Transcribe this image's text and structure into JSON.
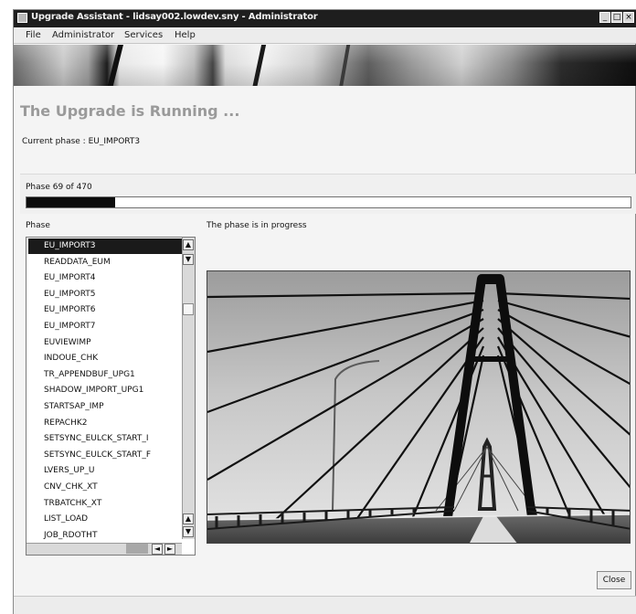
{
  "window": {
    "title": "Upgrade Assistant - lidsay002.lowdev.sny - Administrator",
    "controls": [
      "_",
      "□",
      "×"
    ]
  },
  "menu": [
    "File",
    "Administrator",
    "Services",
    "Help"
  ],
  "page": {
    "title": "The Upgrade is Running ...",
    "current_phase": "Current phase : EU_IMPORT3"
  },
  "progress": {
    "label": "Phase 69 of 470",
    "current": 69,
    "total": 470
  },
  "phase_list": {
    "header": "Phase",
    "items": [
      "EU_IMPORT3",
      "READDATA_EUM",
      "EU_IMPORT4",
      "EU_IMPORT5",
      "EU_IMPORT6",
      "EU_IMPORT7",
      "EUVIEWIMP",
      "INDOUE_CHK",
      "TR_APPENDBUF_UPG1",
      "SHADOW_IMPORT_UPG1",
      "STARTSAP_IMP",
      "REPACHK2",
      "SETSYNC_EULCK_START_I",
      "SETSYNC_EULCK_START_F",
      "LVERS_UP_U",
      "CNV_CHK_XT",
      "TRBATCHK_XT",
      "LIST_LOAD",
      "JOB_RDOTHT"
    ],
    "selected_index": 0
  },
  "status": {
    "text": "The phase is in progress"
  },
  "buttons": {
    "close": "Close"
  },
  "scroll_glyphs": {
    "up": "▲",
    "down": "▼",
    "left": "◄",
    "right": "►"
  },
  "colors": {
    "title_bar": "#1e1e1e",
    "selection": "#1a1a1a",
    "progress_fill": "#0c0c0c",
    "heading": "#9a9a9a"
  }
}
